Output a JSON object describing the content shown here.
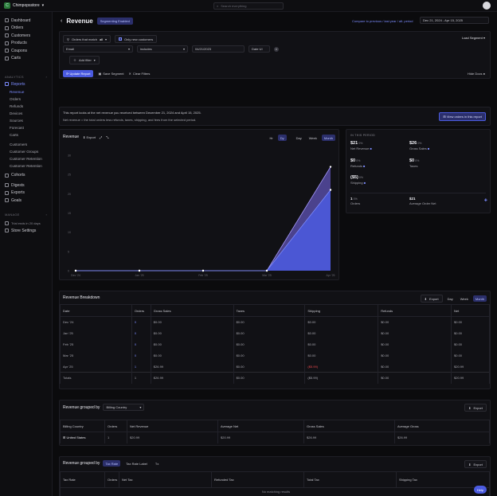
{
  "store": {
    "name": "Chimpopsstore",
    "logo_letter": "C"
  },
  "search": {
    "placeholder": "Search everything"
  },
  "sidebar": {
    "top": [
      "Dashboard",
      "Orders",
      "Customers",
      "Products",
      "Coupons",
      "Carts"
    ],
    "analytics_label": "ANALYTICS",
    "reports": "Reports",
    "report_subs": [
      "Revenue",
      "Orders",
      "Refunds",
      "Devices",
      "Sources",
      "Forecast",
      "Carts",
      "Customers",
      "Customer Groups",
      "Customer Retention",
      "Customer Retention"
    ],
    "extra": [
      "Cohorts",
      "Digests",
      "Exports",
      "Goals"
    ],
    "manage_label": "MANAGE",
    "trial": "Trial ends in 20 days",
    "settings": "Store Settings"
  },
  "header": {
    "title": "Revenue",
    "badge": "Segmenting Enabled",
    "compare": "Compare to previous / last year / alt. period",
    "date_range": "Dec 21, 2024 - Apr 15, 2025"
  },
  "filters": {
    "orders_that_match": "Orders that match",
    "match_value": "all",
    "only_new": "Only new customers",
    "field": "Email",
    "operator": "includes",
    "value": "04/21/2023",
    "date_ui": "Date UI",
    "add_filter": "Add filter",
    "load_segment": "Load Segment",
    "update_report": "Update Report",
    "save_segment": "Save Segment",
    "clear_filters": "Clear Filters",
    "hide_docs": "Hide Docs"
  },
  "info": {
    "line1": "This report looks at the net revenue you received between December 21, 2024 and April 15, 2025.",
    "line2": "Net revenue = the total orders less refunds, taxes, shipping, and fees from the selected period.",
    "button": "View orders in this report"
  },
  "chart": {
    "title": "Revenue",
    "export": "Export",
    "toggles": [
      "Hr",
      "Dy",
      "Day",
      "Week",
      "Month"
    ],
    "toggle_active": "Month"
  },
  "chart_data": {
    "type": "area",
    "categories": [
      "Dec '24",
      "Jan '25",
      "Feb '25",
      "Mar '25",
      "Apr '25"
    ],
    "series": [
      {
        "values": [
          0,
          0,
          0,
          0,
          26.99
        ]
      },
      {
        "values": [
          0,
          0,
          0,
          0,
          21.0
        ]
      }
    ],
    "y_ticks": [
      "30",
      "25",
      "20",
      "15",
      "10",
      "5",
      "0"
    ],
    "ylim": [
      0,
      30
    ],
    "colors": [
      "#7c6cf0",
      "#4b5be0"
    ]
  },
  "summary": {
    "label": "IN THIS PERIOD",
    "metrics": [
      {
        "value": "$21",
        "pct": "0%",
        "label": "Net Revenue"
      },
      {
        "value": "$26",
        "pct": "0%",
        "label": "Gross Sales"
      },
      {
        "value": "$0",
        "pct": "0%",
        "label": "Refunds"
      },
      {
        "value": "$0",
        "pct": "0%",
        "label": "Taxes"
      },
      {
        "value": "($5)",
        "pct": "0%",
        "label": "Shipping"
      },
      {
        "value": "1",
        "pct": "0%",
        "label": "Orders"
      },
      {
        "value": "$21",
        "pct": "",
        "label": "Average Order Net"
      }
    ]
  },
  "breakdown": {
    "title": "Revenue Breakdown",
    "export": "Export",
    "toggles": [
      "Day",
      "Week",
      "Month"
    ],
    "columns": [
      "Date",
      "Orders",
      "Gross Sales",
      "Taxes",
      "Shipping",
      "Refunds",
      "Net"
    ],
    "rows": [
      [
        "Dec '24",
        "0",
        "$0.00",
        "$0.00",
        "$0.00",
        "$0.00",
        "$0.00"
      ],
      [
        "Jan '25",
        "0",
        "$0.00",
        "$0.00",
        "$0.00",
        "$0.00",
        "$0.00"
      ],
      [
        "Feb '25",
        "0",
        "$0.00",
        "$0.00",
        "$0.00",
        "$0.00",
        "$0.00"
      ],
      [
        "Mar '25",
        "0",
        "$0.00",
        "$0.00",
        "$0.00",
        "$0.00",
        "$0.00"
      ],
      [
        "Apr '25",
        "1",
        "$26.99",
        "$0.00",
        "($5.99)",
        "$0.00",
        "$20.99"
      ]
    ],
    "total": [
      "Totals",
      "1",
      "$26.99",
      "$0.00",
      "($5.99)",
      "$0.00",
      "$20.99"
    ]
  },
  "grouped": {
    "title": "Revenue grouped by",
    "select": "Billing Country",
    "export": "Export",
    "columns": [
      "Billing Country",
      "Orders",
      "Net Revenue",
      "Average Net",
      "Gross Sales",
      "Average Gross"
    ],
    "row": [
      "United States",
      "1",
      "$20.99",
      "$20.99",
      "$26.99",
      "$26.99"
    ]
  },
  "tax": {
    "title": "Revenue grouped by",
    "tabs": [
      "Tax Rate",
      "Tax Rate Label",
      "Tx"
    ],
    "export": "Export",
    "columns": [
      "Tax Rate",
      "Orders",
      "Net Tax",
      "Refunded Tax",
      "Total Tax",
      "Shipping Tax"
    ],
    "empty": "No matching results",
    "help": "Help"
  }
}
